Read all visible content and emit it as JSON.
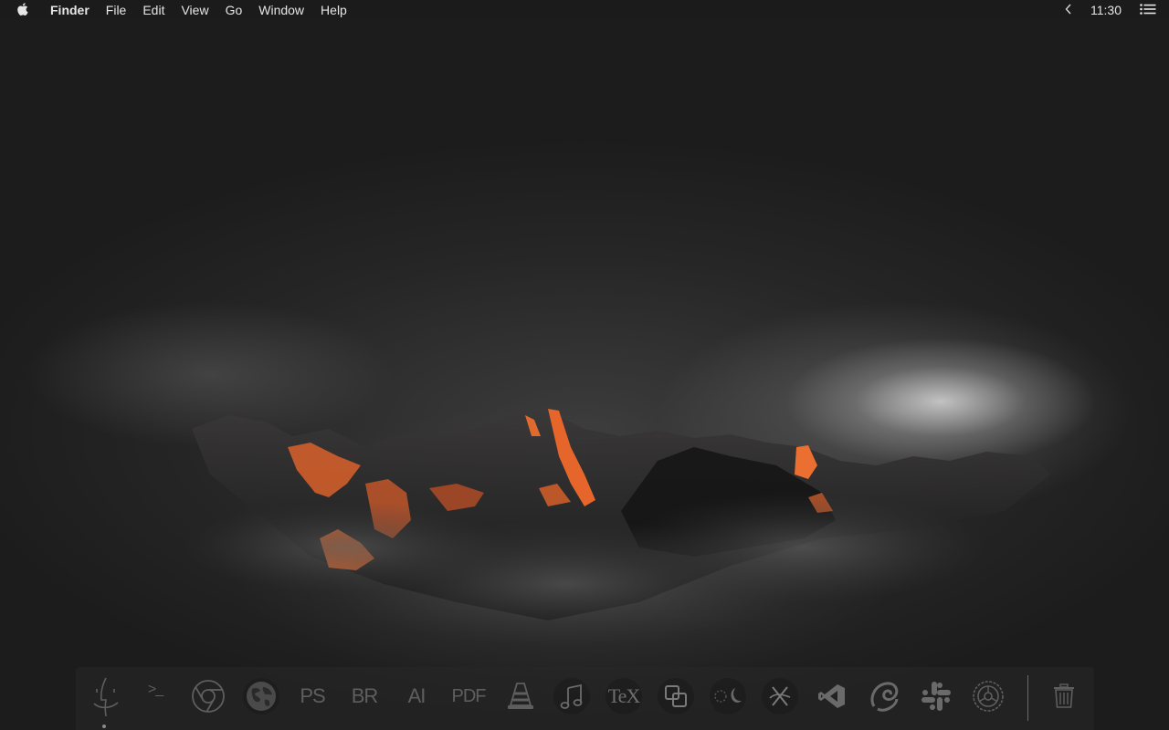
{
  "menubar": {
    "apple_icon": "apple-logo-icon",
    "app_name": "Finder",
    "menus": [
      "File",
      "Edit",
      "View",
      "Go",
      "Window",
      "Help"
    ],
    "collapse_icon": "chevron-left-icon",
    "clock": "11:30",
    "notification_icon": "list-icon"
  },
  "dock": {
    "items": [
      {
        "icon": "finder-icon",
        "running": true
      },
      {
        "icon": "terminal-icon",
        "label": ">_"
      },
      {
        "icon": "chrome-icon"
      },
      {
        "icon": "globe-icon"
      },
      {
        "icon": "photoshop-icon",
        "label": "PS"
      },
      {
        "icon": "bridge-icon",
        "label": "BR"
      },
      {
        "icon": "illustrator-icon",
        "label": "AI"
      },
      {
        "icon": "pdf-icon",
        "label": "PDF"
      },
      {
        "icon": "vlc-cone-icon"
      },
      {
        "icon": "music-note-icon"
      },
      {
        "icon": "tex-icon",
        "label": "TeX"
      },
      {
        "icon": "overlap-squares-icon"
      },
      {
        "icon": "night-shift-icon"
      },
      {
        "icon": "xcode-icon"
      },
      {
        "icon": "visual-studio-icon"
      },
      {
        "icon": "swirl-app-icon"
      },
      {
        "icon": "slack-icon"
      },
      {
        "icon": "system-preferences-gear-icon"
      },
      {
        "icon": "trash-icon"
      }
    ]
  },
  "colors": {
    "menubar_bg": "#1b1b1b",
    "menubar_text": "#e6e6e6",
    "dock_icon": "#5e5e5e",
    "lava_orange": "#e5652a"
  }
}
